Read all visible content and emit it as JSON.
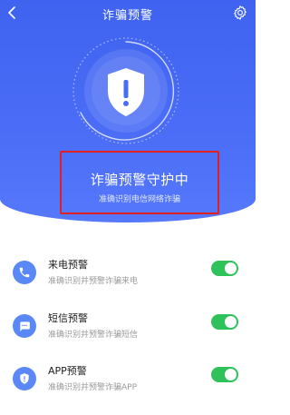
{
  "header": {
    "title": "诈骗预警",
    "back_icon": "chevron-left-icon",
    "settings_icon": "gear-icon"
  },
  "status": {
    "title": "诈骗预警守护中",
    "subtitle": "准确识别电信网络诈骗",
    "icon": "shield-alert-icon"
  },
  "features": [
    {
      "title": "来电预警",
      "subtitle": "准确识别并预警诈骗来电",
      "icon": "phone-icon",
      "enabled": true
    },
    {
      "title": "短信预警",
      "subtitle": "准确识别并预警诈骗短信",
      "icon": "message-icon",
      "enabled": true
    },
    {
      "title": "APP预警",
      "subtitle": "准确识别并预警诈骗APP",
      "icon": "app-shield-icon",
      "enabled": true
    }
  ],
  "colors": {
    "brand_blue": "#4a6cf6",
    "icon_blue": "#5a88f6",
    "toggle_on": "#2fc25b",
    "highlight_red": "#e02020"
  }
}
